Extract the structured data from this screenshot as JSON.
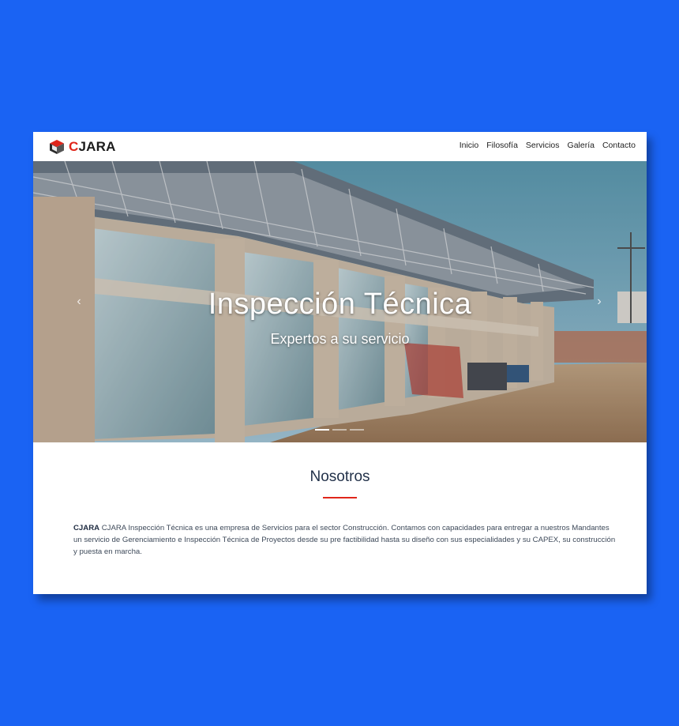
{
  "brand": {
    "name_c": "C",
    "name_rest": "JARA",
    "accent": "#e0261b"
  },
  "nav": {
    "items": [
      "Inicio",
      "Filosofía",
      "Servicios",
      "Galería",
      "Contacto"
    ]
  },
  "hero": {
    "title": "Inspección Técnica",
    "subtitle": "Expertos a su servicio",
    "prev": "‹",
    "next": "›",
    "slides": 3,
    "active_slide": 1
  },
  "about": {
    "title": "Nosotros",
    "lead": "CJARA",
    "text": " CJARA Inspección Técnica es una empresa de Servicios para el sector Construcción. Contamos con capacidades para entregar a nuestros Mandantes un servicio de Gerenciamiento e Inspección Técnica de Proyectos desde su pre factibilidad hasta su diseño con sus especialidades y su CAPEX, su construcción y puesta en marcha."
  },
  "colors": {
    "background": "#1a63f3",
    "heading": "#23324a"
  }
}
